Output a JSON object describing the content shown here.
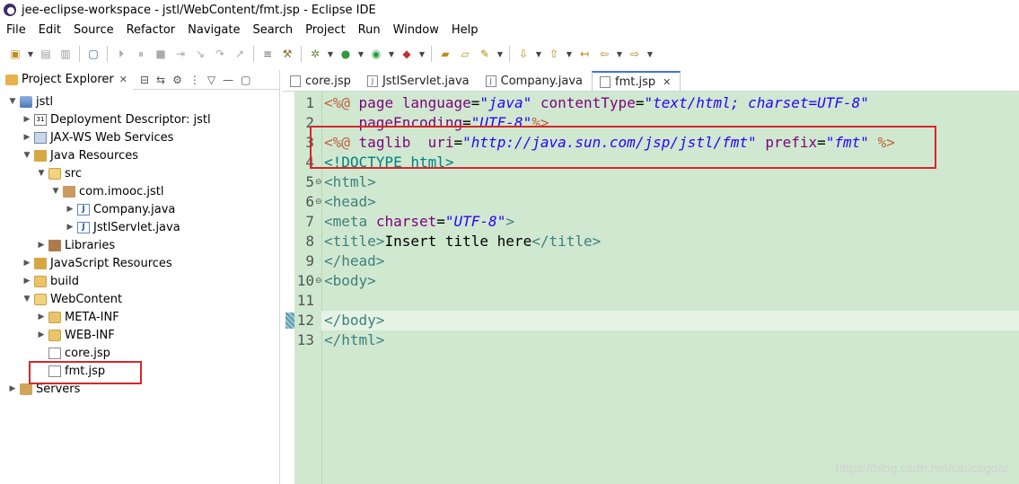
{
  "window": {
    "title": "jee-eclipse-workspace - jstl/WebContent/fmt.jsp - Eclipse IDE"
  },
  "menubar": [
    "File",
    "Edit",
    "Source",
    "Refactor",
    "Navigate",
    "Search",
    "Project",
    "Run",
    "Window",
    "Help"
  ],
  "explorer": {
    "title": "Project Explorer",
    "items": [
      {
        "label": "jstl",
        "icon": "project-icon"
      },
      {
        "label": "Deployment Descriptor: jstl",
        "icon": "descriptor-icon"
      },
      {
        "label": "JAX-WS Web Services",
        "icon": "webservice-icon"
      },
      {
        "label": "Java Resources",
        "icon": "java-resources-icon"
      },
      {
        "label": "src",
        "icon": "source-folder-icon"
      },
      {
        "label": "com.imooc.jstl",
        "icon": "package-icon"
      },
      {
        "label": "Company.java",
        "icon": "java-file-icon"
      },
      {
        "label": "JstlServlet.java",
        "icon": "java-file-icon"
      },
      {
        "label": "Libraries",
        "icon": "library-icon"
      },
      {
        "label": "JavaScript Resources",
        "icon": "js-resources-icon"
      },
      {
        "label": "build",
        "icon": "folder-icon"
      },
      {
        "label": "WebContent",
        "icon": "folder-icon"
      },
      {
        "label": "META-INF",
        "icon": "folder-icon"
      },
      {
        "label": "WEB-INF",
        "icon": "folder-icon"
      },
      {
        "label": "core.jsp",
        "icon": "jsp-file-icon"
      },
      {
        "label": "fmt.jsp",
        "icon": "jsp-file-icon"
      },
      {
        "label": "Servers",
        "icon": "server-icon"
      }
    ]
  },
  "editor": {
    "tabs": [
      {
        "label": "core.jsp",
        "active": false
      },
      {
        "label": "JstlServlet.java",
        "active": false
      },
      {
        "label": "Company.java",
        "active": false
      },
      {
        "label": "fmt.jsp",
        "active": true
      }
    ],
    "line_numbers": [
      "1",
      "2",
      "3",
      "4",
      "5",
      "6",
      "7",
      "8",
      "9",
      "10",
      "11",
      "12",
      "13"
    ],
    "lines": [
      "<%@ page language=\"java\" contentType=\"text/html; charset=UTF-8\"",
      "    pageEncoding=\"UTF-8\"%>",
      "<%@ taglib  uri=\"http://java.sun.com/jsp/jstl/fmt\" prefix=\"fmt\" %>",
      "<!DOCTYPE html>",
      "<html>",
      "<head>",
      "<meta charset=\"UTF-8\">",
      "<title>Insert title here</title>",
      "</head>",
      "<body>",
      "",
      "</body>",
      "</html>"
    ]
  },
  "watermark": "https://blog.csdn.net/csucsgoat",
  "colors": {
    "editor_bg": "#cfe8cf",
    "highlight_box": "#d9262a",
    "directive": "#bf5f3f",
    "tag": "#3f7f7f",
    "attr": "#7f007f",
    "value": "#2a00ff"
  }
}
